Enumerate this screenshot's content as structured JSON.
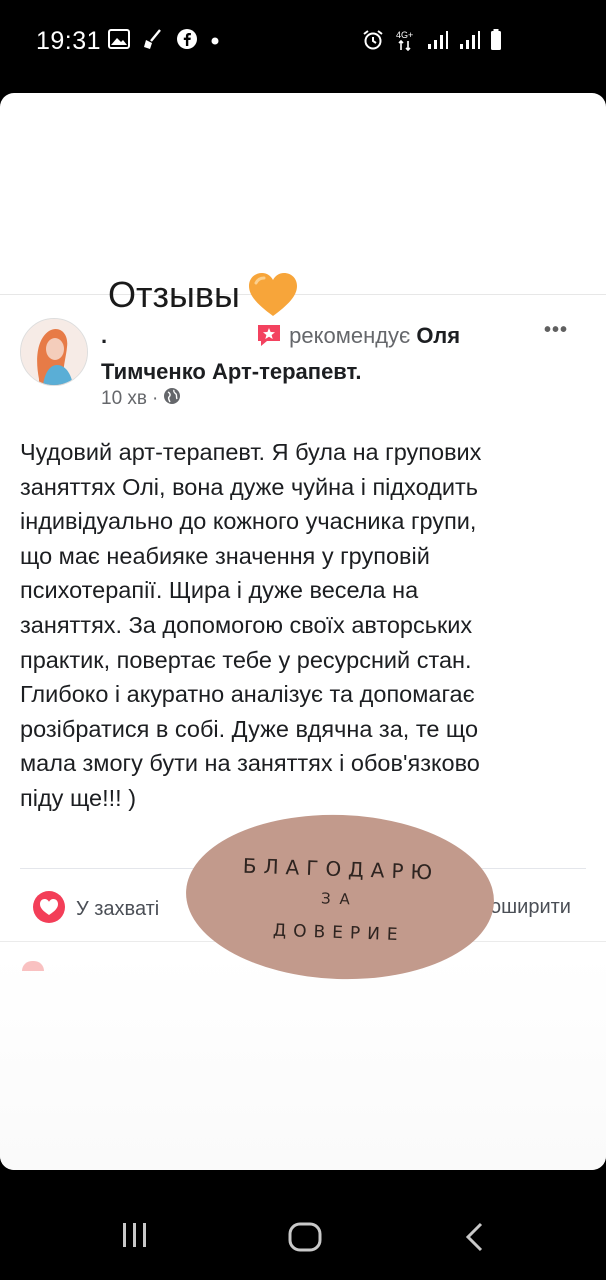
{
  "status_bar": {
    "time": "19:31",
    "network": "4G+"
  },
  "story": {
    "title": "Отзывы",
    "sticker": {
      "line1": "БЛАГОДАРЮ",
      "line2": "ЗА",
      "line3": "ДОВЕРИЕ"
    }
  },
  "post": {
    "author": ".",
    "recommends_text": "рекомендує",
    "page_name_part1": "Оля",
    "page_name_part2": "Тимченко Арт-терапевт.",
    "time": "10 хв",
    "meta_sep": "·",
    "more_label": "•••",
    "body_lines": [
      "Чудовий арт-терапевт. Я була на групових",
      "заняттях Олі, вона дуже чуйна і підходить",
      "індивідуально до кожного учасника групи,",
      "що має неабияке значення у груповій",
      "психотерапії. Щира і дуже весела на",
      "заняттях. За допомогою своїх авторських",
      "практик, повертає тебе у ресурсний стан.",
      "Глибоко і акуратно аналізує та допомагає",
      "розібратися в собі. Дуже вдячна за, те що",
      "мала змогу бути на заняттях і обов'язково",
      "піду ще!!! )"
    ],
    "actions": {
      "like_label": "У захваті",
      "share_label": "оширити"
    }
  },
  "colors": {
    "like_red": "#f33e58",
    "heart_orange": "#f7a53a",
    "sticker_bg": "#c29a8c"
  }
}
